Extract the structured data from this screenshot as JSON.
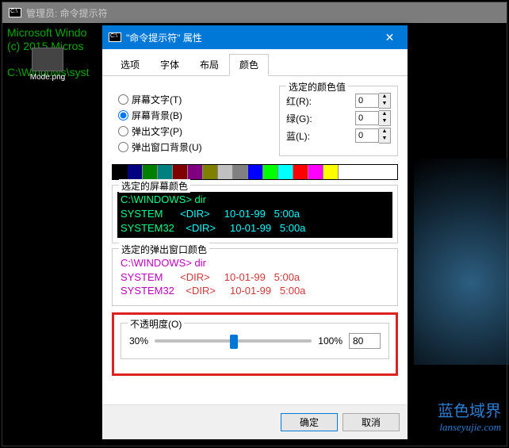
{
  "cmd_window": {
    "title": "管理员: 命令提示符",
    "line1": "Microsoft Windo",
    "line2": "(c) 2015 Micros",
    "line3": "",
    "line4": "C:\\Windows\\syst"
  },
  "desktop_icon": {
    "label": "Mode.png"
  },
  "dialog": {
    "title": "\"命令提示符\" 属性",
    "tabs": {
      "t1": "选项",
      "t2": "字体",
      "t3": "布局",
      "t4": "颜色"
    },
    "radios": {
      "screen_text": "屏幕文字(T)",
      "screen_bg": "屏幕背景(B)",
      "popup_text": "弹出文字(P)",
      "popup_bg": "弹出窗口背景(U)"
    },
    "rgb": {
      "legend": "选定的颜色值",
      "r_label": "红(R):",
      "r_val": "0",
      "g_label": "绿(G):",
      "g_val": "0",
      "b_label": "蓝(L):",
      "b_val": "0"
    },
    "palette_colors": [
      "#000000",
      "#000080",
      "#008000",
      "#008080",
      "#800000",
      "#800080",
      "#808000",
      "#c0c0c0",
      "#808080",
      "#0000ff",
      "#00ff00",
      "#00ffff",
      "#ff0000",
      "#ff00ff",
      "#ffff00",
      "#ffffff"
    ],
    "preview1": {
      "legend": "选定的屏幕颜色",
      "l1": "C:\\WINDOWS> dir",
      "l2a": "SYSTEM      ",
      "l2b": "<DIR>     10-01-99   5:00a",
      "l3a": "SYSTEM32    ",
      "l3b": "<DIR>     10-01-99   5:00a"
    },
    "preview2": {
      "legend": "选定的弹出窗口颜色",
      "l1": "C:\\WINDOWS> dir",
      "l2a": "SYSTEM      ",
      "l2b": "<DIR>     10-01-99   5:00a",
      "l3a": "SYSTEM32    ",
      "l3b": "<DIR>     10-01-99   5:00a"
    },
    "opacity": {
      "legend": "不透明度(O)",
      "min": "30%",
      "max": "100%",
      "value": "80",
      "thumb_left_pct": 48
    },
    "buttons": {
      "ok": "确定",
      "cancel": "取消"
    }
  },
  "watermark": {
    "cn": "蓝色域界",
    "url": "lanseyujie.com"
  }
}
